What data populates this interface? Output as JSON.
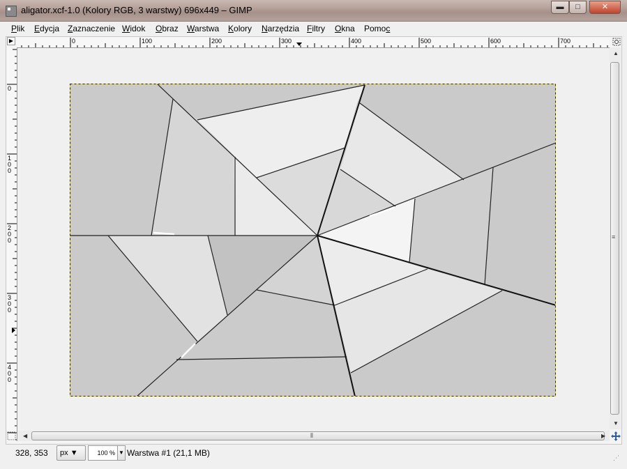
{
  "window": {
    "title": "aligator.xcf-1.0 (Kolory RGB, 3 warstwy) 696x449 – GIMP",
    "minimize_icon": "minimize-icon",
    "maximize_icon": "maximize-icon",
    "close_icon": "close-icon",
    "minimize_glyph": "▬",
    "maximize_glyph": "□",
    "close_glyph": "✕"
  },
  "menu": {
    "items": [
      {
        "pre": "",
        "u": "P",
        "post": "lik"
      },
      {
        "pre": "",
        "u": "E",
        "post": "dycja"
      },
      {
        "pre": "",
        "u": "Z",
        "post": "aznaczenie"
      },
      {
        "pre": "",
        "u": "W",
        "post": "idok"
      },
      {
        "pre": "",
        "u": "O",
        "post": "braz"
      },
      {
        "pre": "",
        "u": "W",
        "post": "arstwa"
      },
      {
        "pre": "",
        "u": "K",
        "post": "olory"
      },
      {
        "pre": "",
        "u": "N",
        "post": "arzędzia"
      },
      {
        "pre": "",
        "u": "F",
        "post": "iltry"
      },
      {
        "pre": "",
        "u": "O",
        "post": "kna"
      },
      {
        "pre": "Pomo",
        "u": "c",
        "post": ""
      }
    ]
  },
  "rulers": {
    "horizontal_labels": [
      "0",
      "100",
      "200",
      "300",
      "400",
      "500",
      "600",
      "700"
    ],
    "vertical_labels": [
      "0",
      "100",
      "200",
      "300",
      "400"
    ]
  },
  "status": {
    "coords": "328, 353",
    "unit": "px",
    "zoom": "100 %",
    "layer": "Warstwa #1 (21,1 MB)"
  },
  "colors": {
    "canvas_bg": "#cccccc",
    "selection_boundary": "#f2dc00",
    "line": "#222222"
  }
}
